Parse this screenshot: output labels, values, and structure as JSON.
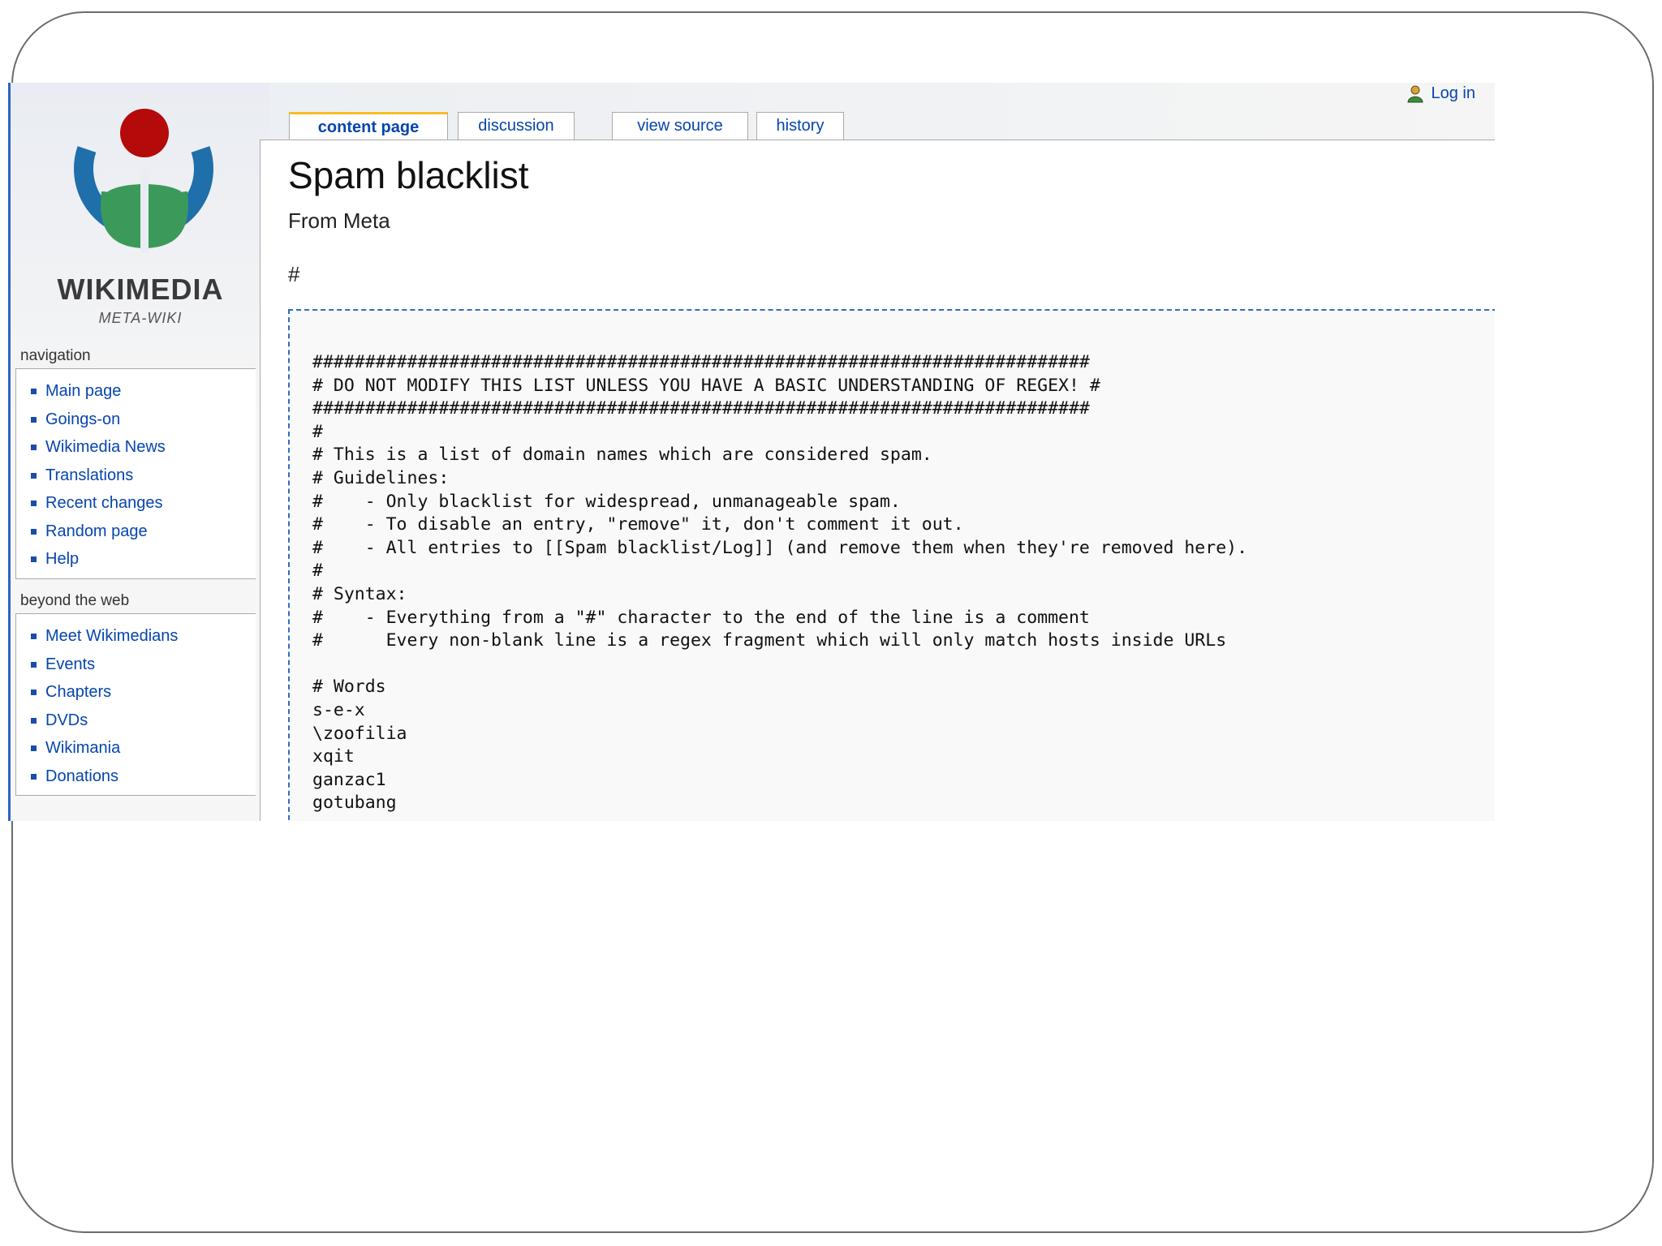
{
  "sidebar": {
    "logo_text": "WIKIMEDIA",
    "logo_subtext": "META-WIKI",
    "navigation": {
      "title": "navigation",
      "items": [
        "Main page",
        "Goings-on",
        "Wikimedia News",
        "Translations",
        "Recent changes",
        "Random page",
        "Help"
      ]
    },
    "beyond": {
      "title": "beyond the web",
      "items": [
        "Meet Wikimedians",
        "Events",
        "Chapters",
        "DVDs",
        "Wikimania",
        "Donations"
      ]
    }
  },
  "tabs": {
    "content_page": "content page",
    "discussion": "discussion",
    "view_source": "view source",
    "history": "history"
  },
  "user": {
    "login": "Log in"
  },
  "page": {
    "title": "Spam blacklist",
    "subtitle": "From Meta",
    "hash": "#",
    "lines": [
      "##########################################################################",
      "# DO NOT MODIFY THIS LIST UNLESS YOU HAVE A BASIC UNDERSTANDING OF REGEX! #",
      "##########################################################################",
      "#",
      "# This is a list of domain names which are considered spam.",
      "# Guidelines:",
      "#    - Only blacklist for widespread, unmanageable spam.",
      "#    - To disable an entry, \"remove\" it, don't comment it out.",
      "#    - All entries to [[Spam blacklist/Log]] (and remove them when they're removed here).",
      "#",
      "# Syntax:",
      "#    - Everything from a \"#\" character to the end of the line is a comment",
      "#      Every non-blank line is a regex fragment which will only match hosts inside URLs",
      "",
      "# Words",
      "s-e-x",
      "\\zoofilia",
      "xqit",
      "ganzac1",
      "gotubang"
    ]
  },
  "colors": {
    "link": "#0645ad",
    "selected_tab": "#fabd23",
    "logo_blue": "#1f6faa",
    "logo_green": "#3b9a5a",
    "logo_red": "#b40a0a"
  }
}
